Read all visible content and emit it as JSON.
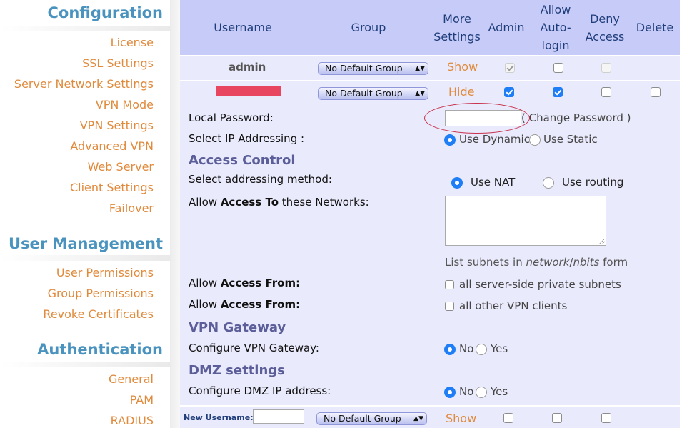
{
  "sidebar": {
    "sections": [
      {
        "title": "Configuration",
        "items": [
          "License",
          "SSL Settings",
          "Server Network Settings",
          "VPN Mode",
          "VPN Settings",
          "Advanced VPN",
          "Web Server",
          "Client Settings",
          "Failover"
        ]
      },
      {
        "title": "User Management",
        "items": [
          "User Permissions",
          "Group Permissions",
          "Revoke Certificates"
        ]
      },
      {
        "title": "Authentication",
        "items": [
          "General",
          "PAM",
          "RADIUS"
        ]
      }
    ]
  },
  "table": {
    "headers": {
      "username": "Username",
      "group": "Group",
      "more1": "More",
      "more2": "Settings",
      "admin": "Admin",
      "auto1": "Allow",
      "auto2": "Auto-",
      "auto3": "login",
      "deny1": "Deny",
      "deny2": "Access",
      "delete": "Delete"
    },
    "rows": [
      {
        "username": "admin",
        "group": "No Default Group",
        "toggle": "Show",
        "admin": true,
        "auto_login": false,
        "deny": false
      },
      {
        "username": "",
        "group": "No Default Group",
        "toggle": "Hide",
        "admin": true,
        "auto_login": true,
        "deny": false,
        "delete": false
      }
    ]
  },
  "details": {
    "local_password_label": "Local Password:",
    "change_password": "( Change Password )",
    "ip_addressing_label": "Select IP Addressing :",
    "use_dynamic": "Use Dynamic",
    "use_static": "Use Static",
    "access_control_heading": "Access Control",
    "addressing_method_label": "Select addressing method:",
    "use_nat": "Use NAT",
    "use_routing": "Use routing",
    "allow_access_to_pre": "Allow ",
    "allow_access_to_bold": "Access To",
    "allow_access_to_post": " these Networks:",
    "subnet_hint_pre": "List subnets in ",
    "subnet_hint_network": "network",
    "subnet_hint_slash": "/",
    "subnet_hint_nbits": "nbits",
    "subnet_hint_post": " form",
    "allow_access_from_pre": "Allow ",
    "allow_access_from_bold": "Access From:",
    "private_subnets": "all server-side private subnets",
    "other_clients": "all other VPN clients",
    "vpn_gateway_heading": "VPN Gateway",
    "configure_gateway_label": "Configure VPN Gateway:",
    "dmz_heading": "DMZ settings",
    "configure_dmz_label": "Configure DMZ IP address:",
    "no": "No",
    "yes": "Yes"
  },
  "new_user": {
    "label": "New Username:",
    "group": "No Default Group",
    "toggle": "Show"
  },
  "colors": {
    "accent_orange": "#e08a3c",
    "header_blue": "#4a93bf",
    "table_header_bg": "#c7cbf7",
    "table_body_bg": "#e9eafc",
    "checkbox_blue": "#1f7ef6",
    "highlight_red": "#c8324b"
  }
}
